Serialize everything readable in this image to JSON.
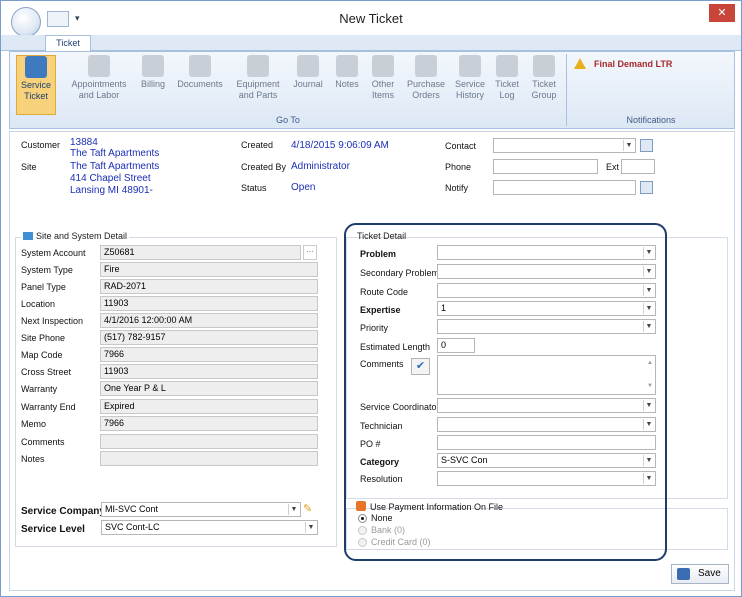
{
  "window": {
    "title": "New Ticket",
    "close": "✕"
  },
  "ribbon": {
    "tab": "Ticket",
    "buttons": [
      {
        "label1": "Service",
        "label2": "Ticket"
      },
      {
        "label1": "Appointments",
        "label2": "and Labor"
      },
      {
        "label1": "Billing",
        "label2": ""
      },
      {
        "label1": "Documents",
        "label2": ""
      },
      {
        "label1": "Equipment",
        "label2": "and Parts"
      },
      {
        "label1": "Journal",
        "label2": ""
      },
      {
        "label1": "Notes",
        "label2": ""
      },
      {
        "label1": "Other",
        "label2": "Items"
      },
      {
        "label1": "Purchase",
        "label2": "Orders"
      },
      {
        "label1": "Service",
        "label2": "History"
      },
      {
        "label1": "Ticket",
        "label2": "Log"
      },
      {
        "label1": "Ticket",
        "label2": "Group"
      }
    ],
    "goto_label": "Go To",
    "notifications_label": "Notifications",
    "notification": "Final Demand LTR"
  },
  "header": {
    "customer_label": "Customer",
    "customer_number": "13884",
    "customer_name": "The Taft Apartments",
    "site_label": "Site",
    "site_name": "The Taft Apartments",
    "site_address1": "414 Chapel Street",
    "site_address2": "Lansing MI 48901-",
    "created_label": "Created",
    "created_value": "4/18/2015 9:06:09 AM",
    "created_by_label": "Created By",
    "created_by_value": "Administrator",
    "status_label": "Status",
    "status_value": "Open",
    "contact_label": "Contact",
    "contact_value": "",
    "phone_label": "Phone",
    "phone_value": "",
    "ext_label": "Ext",
    "ext_value": "",
    "notify_label": "Notify",
    "notify_value": ""
  },
  "site_detail": {
    "title": "Site and System Detail",
    "rows": [
      {
        "label": "System Account",
        "value": "Z50681"
      },
      {
        "label": "System Type",
        "value": "Fire"
      },
      {
        "label": "Panel Type",
        "value": "RAD-2071"
      },
      {
        "label": "Location",
        "value": "11903"
      },
      {
        "label": "Next Inspection",
        "value": "4/1/2016 12:00:00 AM"
      },
      {
        "label": "Site Phone",
        "value": "(517) 782-9157"
      },
      {
        "label": "Map Code",
        "value": "7966"
      },
      {
        "label": "Cross Street",
        "value": "11903"
      },
      {
        "label": "Warranty",
        "value": "One Year P & L"
      },
      {
        "label": "Warranty End",
        "value": "Expired"
      },
      {
        "label": "Memo",
        "value": "7966"
      },
      {
        "label": "Comments",
        "value": ""
      },
      {
        "label": "Notes",
        "value": ""
      }
    ],
    "service_company_label": "Service Company",
    "service_company_value": "MI-SVC Cont",
    "service_level_label": "Service Level",
    "service_level_value": "SVC Cont-LC"
  },
  "ticket_detail": {
    "title": "Ticket Detail",
    "problem_label": "Problem",
    "problem_value": "",
    "secondary_problem_label": "Secondary Problem",
    "secondary_problem_value": "",
    "route_code_label": "Route Code",
    "route_code_value": "",
    "expertise_label": "Expertise",
    "expertise_value": "1",
    "priority_label": "Priority",
    "priority_value": "",
    "estimated_length_label": "Estimated Length",
    "estimated_length_value": "0",
    "comments_label": "Comments",
    "comments_value": "",
    "service_coordinator_label": "Service Coordinator",
    "service_coordinator_value": "",
    "technician_label": "Technician",
    "technician_value": "",
    "po_label": "PO #",
    "po_value": "",
    "category_label": "Category",
    "category_value": "S-SVC Con",
    "resolution_label": "Resolution",
    "resolution_value": ""
  },
  "payment": {
    "title": "Use Payment Information On File",
    "options": [
      "None",
      "Bank (0)",
      "Credit Card (0)"
    ]
  },
  "footer": {
    "save_label": "Save"
  }
}
